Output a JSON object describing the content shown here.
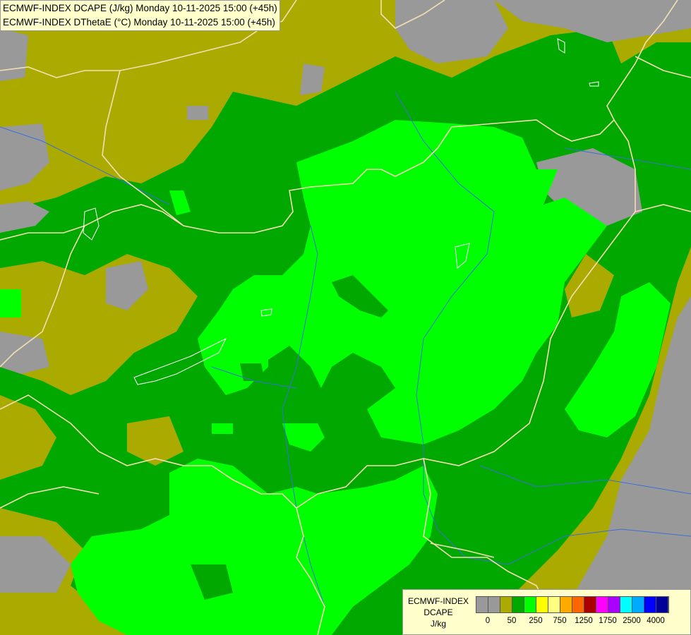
{
  "titles": [
    "ECMWF-INDEX DCAPE (J/kg) Monday 10-11-2025 15:00 (+45h)",
    "ECMWF-INDEX DThetaE (°C) Monday 10-11-2025 15:00 (+45h)"
  ],
  "legend": {
    "line1": "ECMWF-INDEX",
    "line2": "DCAPE",
    "unit": "J/kg",
    "colors": [
      "#999999",
      "#999999",
      "#aaaa00",
      "#00a800",
      "#00ff00",
      "#ffff00",
      "#ffff80",
      "#ffaa00",
      "#ff6600",
      "#aa0000",
      "#ff00ff",
      "#aa00ff",
      "#00ffff",
      "#00aaff",
      "#0000ff",
      "#000099"
    ],
    "tick_labels": [
      "0",
      "50",
      "250",
      "750",
      "1250",
      "1750",
      "2500",
      "4000"
    ]
  },
  "palette": {
    "none": "#999999",
    "low": "#aaaa00",
    "mid": "#00a800",
    "high": "#00ff00",
    "border": "#f5deb3",
    "river": "#3a6fd8"
  }
}
